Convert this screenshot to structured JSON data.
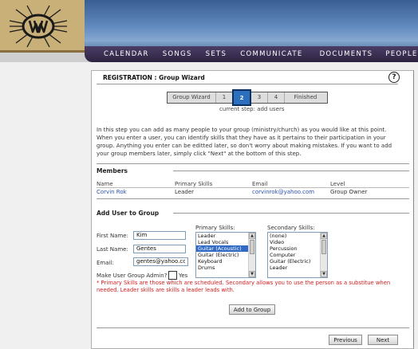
{
  "nav": {
    "items": [
      "CALENDAR",
      "SONGS",
      "SETS",
      "COMMUNICATE",
      "DOCUMENTS",
      "PEOPLE"
    ]
  },
  "panel": {
    "title": "REGISTRATION : Group Wizard",
    "help": "?"
  },
  "steps": {
    "labels": [
      "Group Wizard",
      "1",
      "2",
      "3",
      "4",
      "Finished"
    ],
    "active": "2",
    "current_text": "current step: add users"
  },
  "intro": "In this step you can add as many people to your group (ministry/church) as you would like at this point. When you enter a user, you can identify skills that they have as it pertains to their participation in your group. Anything you enter can be editted later, so don't worry about making mistakes. If you want to add your group members later, simply click \"Next\" at the bottom of this step.",
  "members": {
    "heading": "Members",
    "columns": [
      "Name",
      "Primary Skills",
      "Email",
      "Level"
    ],
    "rows": [
      {
        "name": "Corvin Rok",
        "skills": "Leader",
        "email": "corvinrok@yahoo.com",
        "level": "Group Owner"
      }
    ]
  },
  "add_user": {
    "heading": "Add User to Group",
    "first_name_label": "First Name:",
    "first_name_value": "Kim",
    "last_name_label": "Last Name:",
    "last_name_value": "Gentes",
    "email_label": "Email:",
    "email_value": "gentes@yahoo.com",
    "admin_label": "Make User Group Admin?",
    "admin_yes": "Yes",
    "primary_label": "Primary Skills:",
    "primary_options": [
      "Leader",
      "Lead Vocals",
      "Guitar (Acoustic)",
      "Guitar (Electric)",
      "Keyboard",
      "Drums"
    ],
    "primary_selected": "Guitar (Acoustic)",
    "secondary_label": "Secondary Skills:",
    "secondary_options": [
      "(none)",
      "Video",
      "Percussion",
      "Computer",
      "Guitar (Electric)",
      "Leader"
    ],
    "note": "* Primary Skills are those which are scheduled. Secondary allows you to use the person as a substitue when needed. Leader skills are skills a leader leads with.",
    "add_button": "Add to Group"
  },
  "footer": {
    "previous": "Previous",
    "next": "Next"
  },
  "colors": {
    "nav_bg": "#2d2440",
    "logo_gold": "#c8b078",
    "step_active": "#2c6fbf",
    "link": "#2a4fb0",
    "note": "#d02020",
    "selected": "#316ac5"
  }
}
